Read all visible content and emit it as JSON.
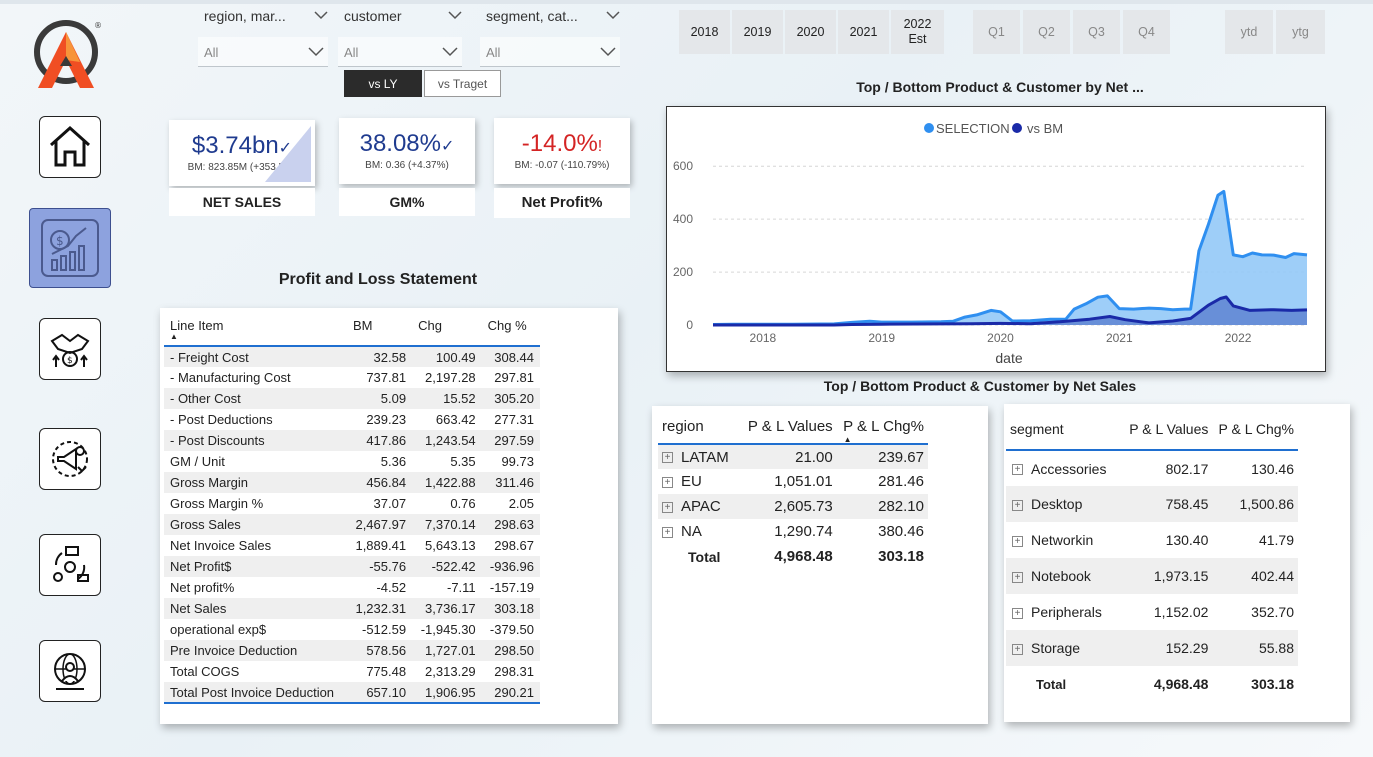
{
  "filters": [
    {
      "label": "region, mar...",
      "value": "All"
    },
    {
      "label": "customer",
      "value": "All"
    },
    {
      "label": "segment, cat...",
      "value": "All"
    }
  ],
  "compare": {
    "vs_ly": "vs LY",
    "vs_target": "vs Traget"
  },
  "years": [
    "2018",
    "2019",
    "2020",
    "2021",
    "2022\nEst"
  ],
  "quarters": [
    "Q1",
    "Q2",
    "Q3",
    "Q4"
  ],
  "ytd": [
    "ytd",
    "ytg"
  ],
  "sidebar": {
    "icons": [
      "home-icon",
      "finance-icon",
      "handshake-icon",
      "marketing-icon",
      "supply-chain-icon",
      "global-user-icon"
    ],
    "active_index": 1,
    "active_color": "#8da2de"
  },
  "kpis": [
    {
      "value": "$3.74bn",
      "flag": "✓",
      "sub": "BM: 823.85M (+353.5%)",
      "label": "NET SALES",
      "color": "#1f3b8f"
    },
    {
      "value": "38.08%",
      "flag": "✓",
      "sub": "BM: 0.36 (+4.37%)",
      "label": "GM%",
      "color": "#1f3b8f"
    },
    {
      "value": "-14.0%",
      "flag": "!",
      "sub": "BM: -0.07 (-110.79%)",
      "label": "Net Profit%",
      "color": "#d42424"
    }
  ],
  "pl": {
    "title": "Profit and Loss Statement",
    "columns": [
      "Line Item",
      "BM",
      "Chg",
      "Chg %"
    ],
    "rows": [
      [
        "- Freight Cost",
        "32.58",
        "100.49",
        "308.44"
      ],
      [
        "- Manufacturing Cost",
        "737.81",
        "2,197.28",
        "297.81"
      ],
      [
        "- Other Cost",
        "5.09",
        "15.52",
        "305.20"
      ],
      [
        "- Post Deductions",
        "239.23",
        "663.42",
        "277.31"
      ],
      [
        "- Post Discounts",
        "417.86",
        "1,243.54",
        "297.59"
      ],
      [
        "GM / Unit",
        "5.36",
        "5.35",
        "99.73"
      ],
      [
        "Gross Margin",
        "456.84",
        "1,422.88",
        "311.46"
      ],
      [
        "Gross Margin %",
        "37.07",
        "0.76",
        "2.05"
      ],
      [
        "Gross Sales",
        "2,467.97",
        "7,370.14",
        "298.63"
      ],
      [
        "Net Invoice Sales",
        "1,889.41",
        "5,643.13",
        "298.67"
      ],
      [
        "Net Profit$",
        "-55.76",
        "-522.42",
        "-936.96"
      ],
      [
        "Net profit%",
        "-4.52",
        "-7.11",
        "-157.19"
      ],
      [
        "Net Sales",
        "1,232.31",
        "3,736.17",
        "303.18"
      ],
      [
        "operational exp$",
        "-512.59",
        "-1,945.30",
        "-379.50"
      ],
      [
        "Pre Invoice Deduction",
        "578.56",
        "1,727.01",
        "298.50"
      ],
      [
        "Total COGS",
        "775.48",
        "2,313.29",
        "298.31"
      ],
      [
        "Total Post Invoice Deduction",
        "657.10",
        "1,906.95",
        "290.21"
      ]
    ]
  },
  "chart_title": "Top / Bottom Product & Customer by Net ...",
  "chart_data": {
    "type": "area",
    "xlabel": "date",
    "ylabel": "",
    "x_ticks": [
      "2018",
      "2019",
      "2020",
      "2021",
      "2022"
    ],
    "y_ticks": [
      "0",
      "200",
      "400",
      "600"
    ],
    "ylim": [
      0,
      650
    ],
    "xlim": [
      2017.58,
      2022.58
    ],
    "grid": true,
    "legend_position": "top",
    "series": [
      {
        "name": "SELECTION",
        "color": "#2f8ff0",
        "fill": "#93c9f7",
        "points": [
          [
            2017.58,
            2
          ],
          [
            2017.75,
            3
          ],
          [
            2018.0,
            3
          ],
          [
            2018.25,
            3
          ],
          [
            2018.6,
            4
          ],
          [
            2018.75,
            10
          ],
          [
            2018.9,
            14
          ],
          [
            2019.0,
            11
          ],
          [
            2019.25,
            11
          ],
          [
            2019.5,
            12
          ],
          [
            2019.6,
            14
          ],
          [
            2019.7,
            30
          ],
          [
            2019.8,
            38
          ],
          [
            2019.92,
            55
          ],
          [
            2020.0,
            50
          ],
          [
            2020.1,
            15
          ],
          [
            2020.25,
            16
          ],
          [
            2020.42,
            22
          ],
          [
            2020.55,
            22
          ],
          [
            2020.62,
            60
          ],
          [
            2020.72,
            80
          ],
          [
            2020.82,
            105
          ],
          [
            2020.9,
            110
          ],
          [
            2021.0,
            62
          ],
          [
            2021.12,
            60
          ],
          [
            2021.25,
            64
          ],
          [
            2021.35,
            62
          ],
          [
            2021.45,
            58
          ],
          [
            2021.55,
            60
          ],
          [
            2021.6,
            60
          ],
          [
            2021.67,
            280
          ],
          [
            2021.75,
            380
          ],
          [
            2021.83,
            490
          ],
          [
            2021.88,
            505
          ],
          [
            2021.96,
            265
          ],
          [
            2022.04,
            258
          ],
          [
            2022.12,
            272
          ],
          [
            2022.2,
            265
          ],
          [
            2022.3,
            264
          ],
          [
            2022.4,
            255
          ],
          [
            2022.47,
            270
          ],
          [
            2022.58,
            265
          ]
        ]
      },
      {
        "name": "vs BM",
        "color": "#1a2aa8",
        "fill": "#5a7fd0",
        "points": [
          [
            2017.58,
            0
          ],
          [
            2018.6,
            0
          ],
          [
            2018.75,
            2
          ],
          [
            2019.0,
            3
          ],
          [
            2019.5,
            4
          ],
          [
            2019.75,
            5
          ],
          [
            2020.0,
            6
          ],
          [
            2020.25,
            5
          ],
          [
            2020.5,
            12
          ],
          [
            2020.75,
            22
          ],
          [
            2020.92,
            32
          ],
          [
            2021.05,
            20
          ],
          [
            2021.25,
            8
          ],
          [
            2021.45,
            15
          ],
          [
            2021.6,
            25
          ],
          [
            2021.75,
            75
          ],
          [
            2021.85,
            100
          ],
          [
            2021.9,
            106
          ],
          [
            2021.96,
            72
          ],
          [
            2022.1,
            55
          ],
          [
            2022.3,
            58
          ],
          [
            2022.45,
            55
          ],
          [
            2022.58,
            57
          ]
        ]
      }
    ]
  },
  "region_table": {
    "title": "Top / Bottom Product & Customer by Net Sales",
    "columns": [
      "region",
      "P & L Values",
      "P & L Chg%"
    ],
    "rows": [
      [
        "LATAM",
        "21.00",
        "239.67"
      ],
      [
        "EU",
        "1,051.01",
        "281.46"
      ],
      [
        "APAC",
        "2,605.73",
        "282.10"
      ],
      [
        "NA",
        "1,290.74",
        "380.46"
      ]
    ],
    "total": [
      "Total",
      "4,968.48",
      "303.18"
    ]
  },
  "segment_table": {
    "columns": [
      "segment",
      "P & L Values",
      "P & L Chg%"
    ],
    "rows": [
      [
        "Accessories",
        "802.17",
        "130.46"
      ],
      [
        "Desktop",
        "758.45",
        "1,500.86"
      ],
      [
        "Networkin",
        "130.40",
        "41.79"
      ],
      [
        "Notebook",
        "1,973.15",
        "402.44"
      ],
      [
        "Peripherals",
        "1,152.02",
        "352.70"
      ],
      [
        "Storage",
        "152.29",
        "55.88"
      ]
    ],
    "total": [
      "Total",
      "4,968.48",
      "303.18"
    ]
  }
}
